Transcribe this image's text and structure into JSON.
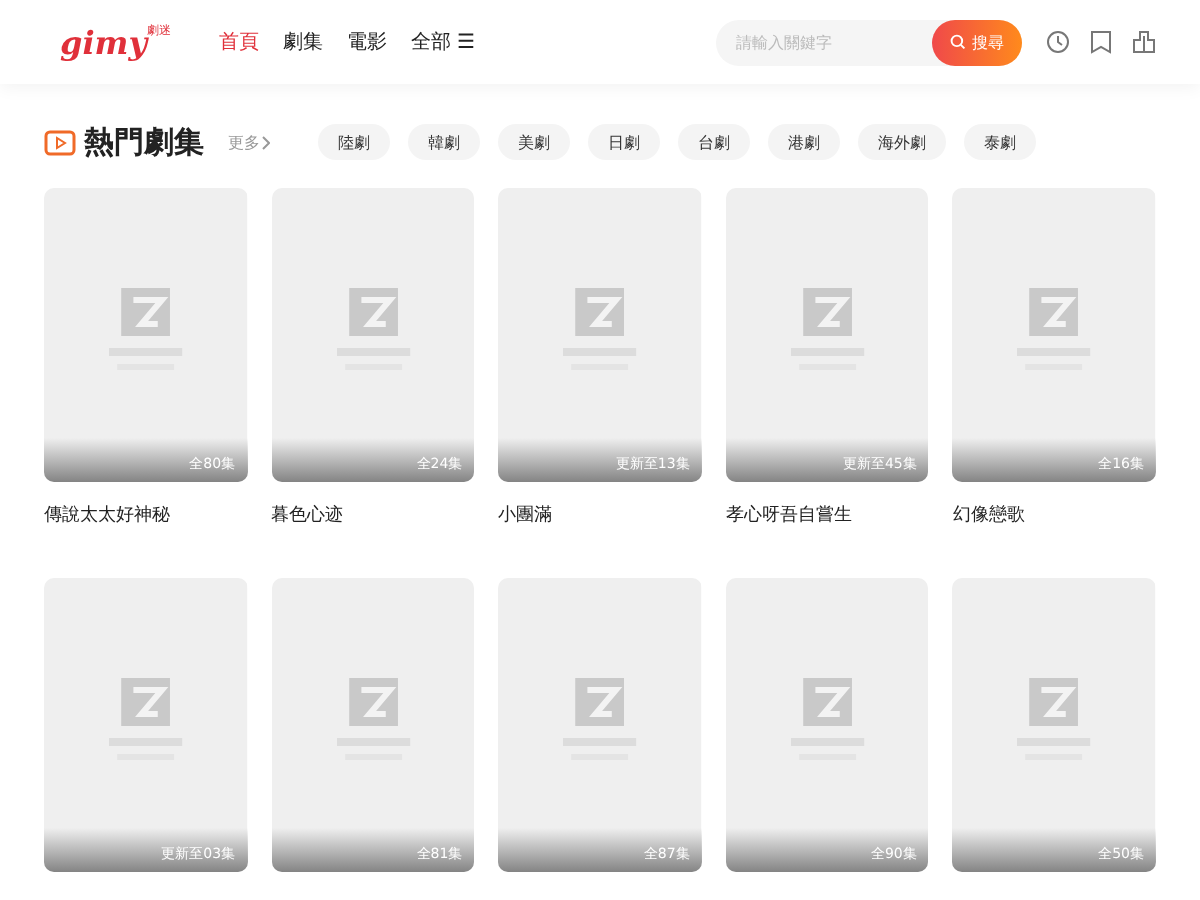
{
  "header": {
    "logo": "gimy",
    "logo_tag": "劇迷",
    "nav": [
      {
        "label": "首頁",
        "selected": true
      },
      {
        "label": "劇集",
        "selected": false
      },
      {
        "label": "電影",
        "selected": false
      },
      {
        "label": "全部",
        "selected": false,
        "menu": "☰"
      }
    ],
    "search": {
      "placeholder": "請輸入關鍵字",
      "button": "搜尋"
    }
  },
  "section": {
    "title": "熱門劇集",
    "more": "更多",
    "tags": [
      "陸劇",
      "韓劇",
      "美劇",
      "日劇",
      "台劇",
      "港劇",
      "海外劇",
      "泰劇"
    ],
    "items": [
      {
        "title": "傳說太太好神秘",
        "badge": "全80集"
      },
      {
        "title": "暮色心迹",
        "badge": "全24集"
      },
      {
        "title": "小團滿",
        "badge": "更新至13集"
      },
      {
        "title": "孝心呀吾自嘗生",
        "badge": "更新至45集"
      },
      {
        "title": "幻像戀歌",
        "badge": "全16集"
      },
      {
        "badge": "更新至03集"
      },
      {
        "badge": "全81集"
      },
      {
        "badge": "全87集"
      },
      {
        "badge": "全90集"
      },
      {
        "badge": "全50集"
      }
    ]
  }
}
